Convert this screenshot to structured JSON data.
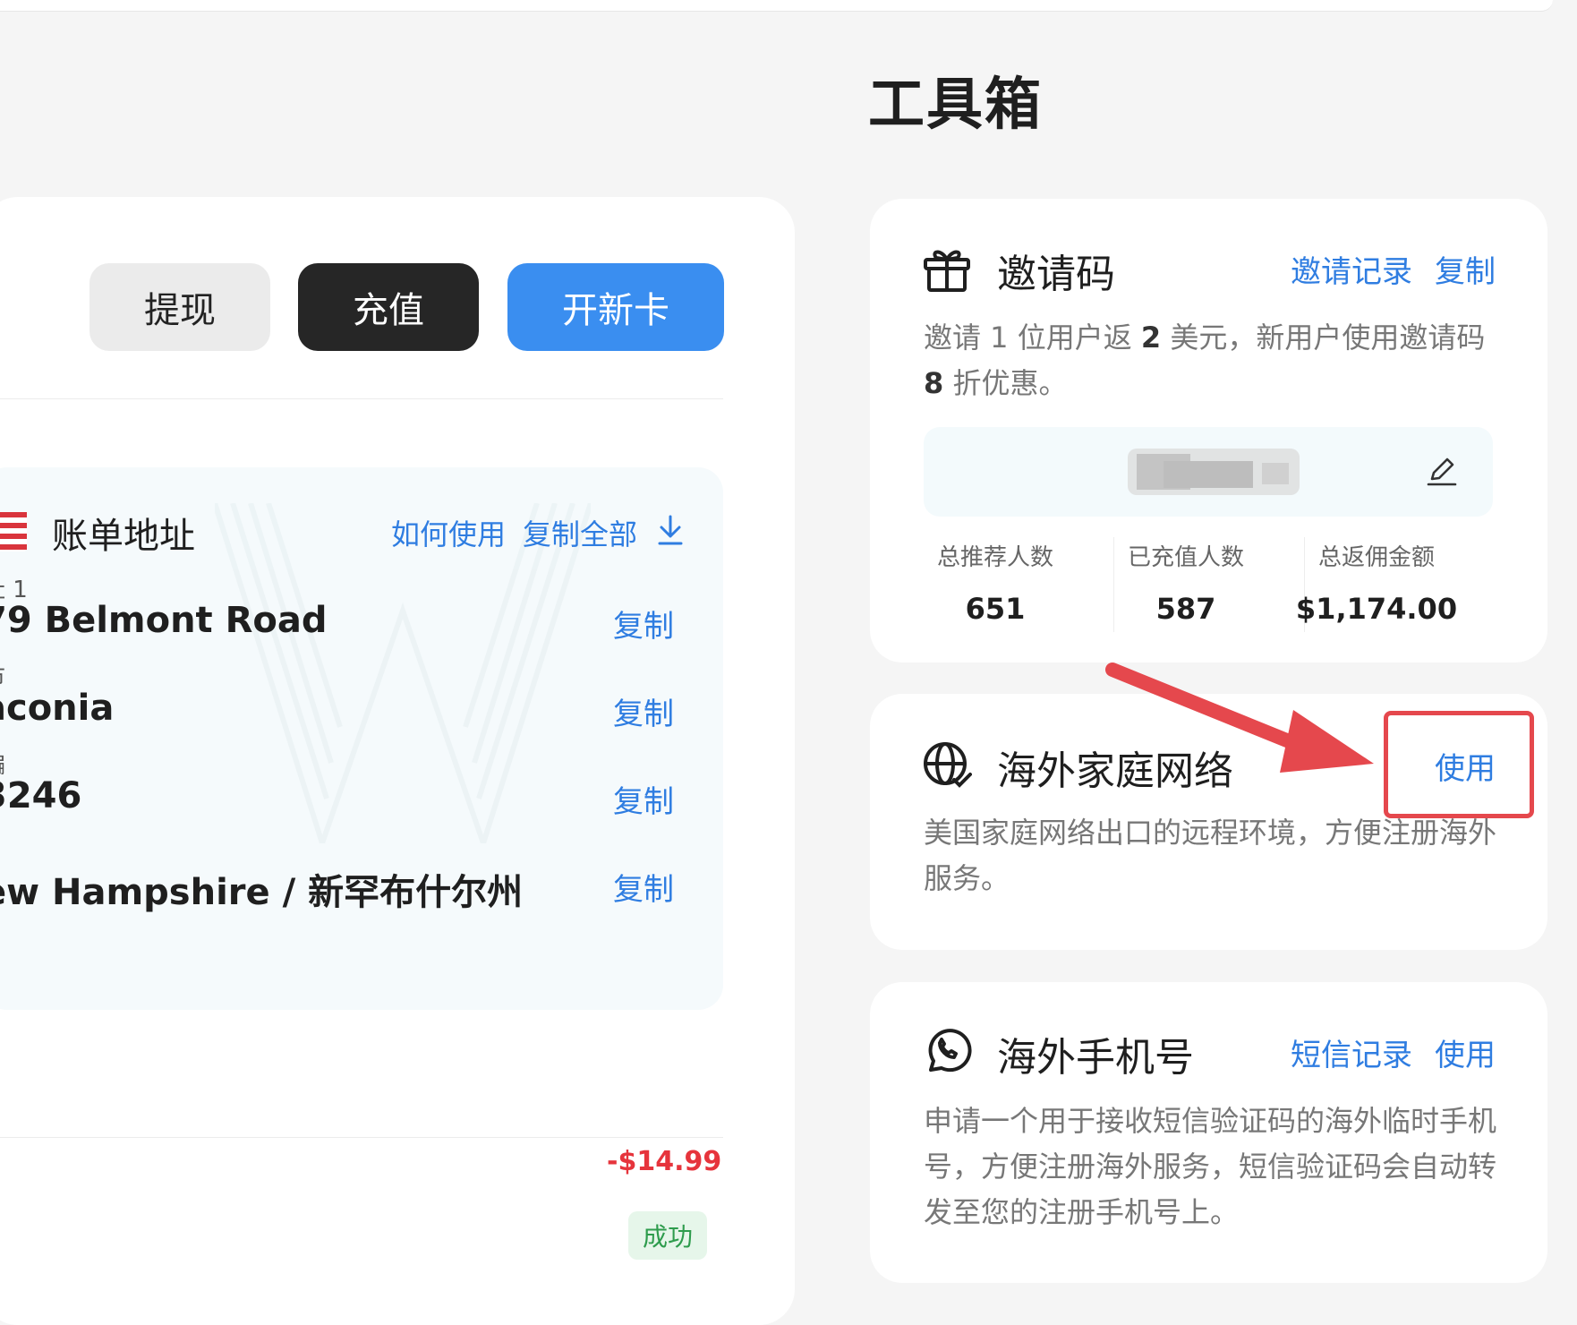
{
  "page": {
    "title": "工具箱"
  },
  "left": {
    "buttons": {
      "withdraw": "提现",
      "recharge": "充值",
      "new_card": "开新卡"
    },
    "billing": {
      "title": "账单地址",
      "how_to_use": "如何使用",
      "copy_all": "复制全部",
      "fields": [
        {
          "label": "址 1",
          "value": "79 Belmont Road",
          "copy": "复制"
        },
        {
          "label": "市",
          "value": "aconia",
          "copy": "复制"
        },
        {
          "label": "编",
          "value": "3246",
          "copy": "复制"
        },
        {
          "label": "",
          "value": "ew Hampshire / 新罕布什尔州",
          "copy": "复制"
        }
      ]
    },
    "transaction": {
      "amount": "-$14.99",
      "status": "成功"
    }
  },
  "invite_card": {
    "title": "邀请码",
    "records_link": "邀请记录",
    "copy_link": "复制",
    "desc_a": "邀请 1 位用户返 ",
    "desc_b": "2",
    "desc_c": " 美元，新用户使用邀请码 ",
    "desc_d": "8",
    "desc_e": " 折优惠。",
    "stats": [
      {
        "label": "总推荐人数",
        "value": "651"
      },
      {
        "label": "已充值人数",
        "value": "587"
      },
      {
        "label": "总返佣金额",
        "value": "$1,174.00"
      }
    ]
  },
  "network_card": {
    "title": "海外家庭网络",
    "use_link": "使用",
    "desc": "美国家庭网络出口的远程环境，方便注册海外服务。"
  },
  "phone_card": {
    "title": "海外手机号",
    "sms_link": "短信记录",
    "use_link": "使用",
    "desc": "申请一个用于接收短信验证码的海外临时手机号，方便注册海外服务，短信验证码会自动转发至您的注册手机号上。"
  },
  "icons": {
    "invite": "gift-icon",
    "network": "globe-icon",
    "phone": "whatsapp-phone-icon",
    "edit": "pencil-icon",
    "download": "download-icon",
    "flag": "us-flag-icon"
  },
  "colors": {
    "accent": "#3a8ef0",
    "link": "#2f7de1",
    "danger": "#e6343c",
    "success": "#2e9c4d",
    "annotation": "#e5484d"
  }
}
